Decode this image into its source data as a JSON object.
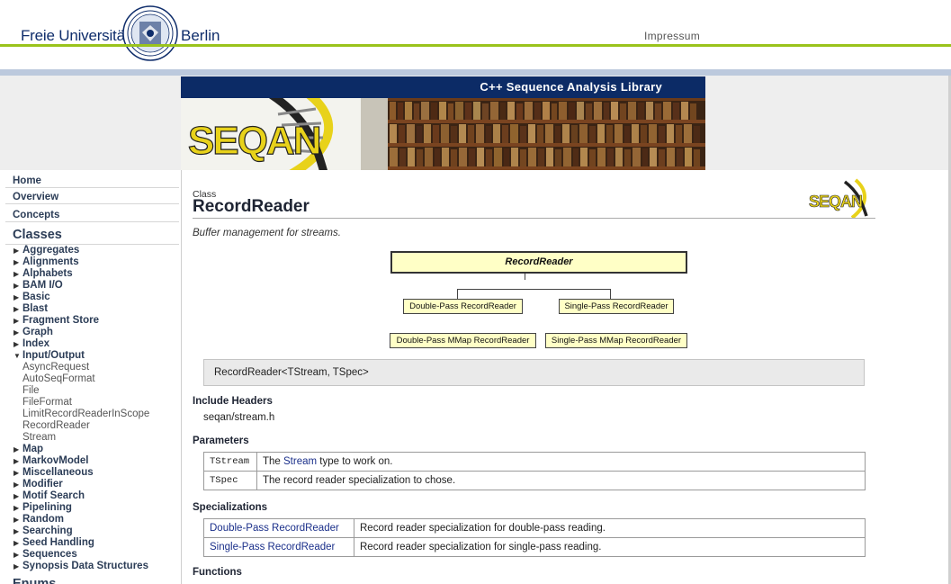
{
  "header": {
    "university_left": "Freie Universität",
    "university_right": "Berlin",
    "impressum": "Impressum"
  },
  "banner": {
    "title": "C++ Sequence Analysis Library",
    "logo_text": "SEQAN"
  },
  "sidebar": {
    "top_links": [
      "Home",
      "Overview",
      "Concepts"
    ],
    "classes_heading": "Classes",
    "categories": [
      {
        "label": "Aggregates",
        "expanded": false
      },
      {
        "label": "Alignments",
        "expanded": false
      },
      {
        "label": "Alphabets",
        "expanded": false
      },
      {
        "label": "BAM I/O",
        "expanded": false
      },
      {
        "label": "Basic",
        "expanded": false
      },
      {
        "label": "Blast",
        "expanded": false
      },
      {
        "label": "Fragment Store",
        "expanded": false
      },
      {
        "label": "Graph",
        "expanded": false
      },
      {
        "label": "Index",
        "expanded": false
      },
      {
        "label": "Input/Output",
        "expanded": true,
        "children": [
          "AsyncRequest",
          "AutoSeqFormat",
          "File",
          "FileFormat",
          "LimitRecordReaderInScope",
          "RecordReader",
          "Stream"
        ]
      },
      {
        "label": "Map",
        "expanded": false
      },
      {
        "label": "MarkovModel",
        "expanded": false
      },
      {
        "label": "Miscellaneous",
        "expanded": false
      },
      {
        "label": "Modifier",
        "expanded": false
      },
      {
        "label": "Motif Search",
        "expanded": false
      },
      {
        "label": "Pipelining",
        "expanded": false
      },
      {
        "label": "Random",
        "expanded": false
      },
      {
        "label": "Searching",
        "expanded": false
      },
      {
        "label": "Seed Handling",
        "expanded": false
      },
      {
        "label": "Sequences",
        "expanded": false
      },
      {
        "label": "Synopsis Data Structures",
        "expanded": false
      }
    ],
    "partial_next_heading": "Enums"
  },
  "main": {
    "kind": "Class",
    "title": "RecordReader",
    "logo_text": "SEQAN",
    "brief": "Buffer management for streams.",
    "diagram": {
      "root": "RecordReader",
      "level1": [
        "Double-Pass RecordReader",
        "Single-Pass RecordReader"
      ],
      "level2": [
        "Double-Pass MMap RecordReader",
        "Single-Pass MMap RecordReader"
      ]
    },
    "signature": "RecordReader<TStream, TSpec>",
    "include_headers_title": "Include Headers",
    "include_header": "seqan/stream.h",
    "parameters_title": "Parameters",
    "parameters": [
      {
        "name": "TStream",
        "desc_pre": "The ",
        "desc_link": "Stream",
        "desc_post": " type to work on."
      },
      {
        "name": "TSpec",
        "desc_pre": "The record reader specialization to chose.",
        "desc_link": "",
        "desc_post": ""
      }
    ],
    "specializations_title": "Specializations",
    "specializations": [
      {
        "name": "Double-Pass RecordReader",
        "desc": "Record reader specialization for double-pass reading."
      },
      {
        "name": "Single-Pass RecordReader",
        "desc": "Record reader specialization for single-pass reading."
      }
    ],
    "functions_title": "Functions"
  }
}
